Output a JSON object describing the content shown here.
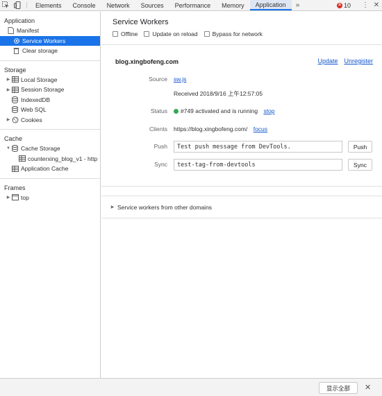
{
  "tabs": [
    {
      "label": "Elements"
    },
    {
      "label": "Console"
    },
    {
      "label": "Network"
    },
    {
      "label": "Sources"
    },
    {
      "label": "Performance"
    },
    {
      "label": "Memory"
    },
    {
      "label": "Application"
    }
  ],
  "active_tab": "Application",
  "tabs_more_glyph": "»",
  "error_count": "10",
  "sidebar": {
    "application": {
      "title": "Application",
      "items": [
        {
          "label": "Manifest",
          "icon": "document-icon"
        },
        {
          "label": "Service Workers",
          "icon": "gear-icon"
        },
        {
          "label": "Clear storage",
          "icon": "trash-icon"
        }
      ]
    },
    "storage": {
      "title": "Storage",
      "items": [
        {
          "label": "Local Storage",
          "icon": "grid-icon"
        },
        {
          "label": "Session Storage",
          "icon": "grid-icon"
        },
        {
          "label": "IndexedDB",
          "icon": "database-icon"
        },
        {
          "label": "Web SQL",
          "icon": "database-icon"
        },
        {
          "label": "Cookies",
          "icon": "cookie-icon"
        }
      ]
    },
    "cache": {
      "title": "Cache",
      "items": [
        {
          "label": "Cache Storage",
          "icon": "database-icon"
        },
        {
          "label": "counterxing_blog_v1 - http",
          "icon": "grid-icon"
        },
        {
          "label": "Application Cache",
          "icon": "grid-icon"
        }
      ]
    },
    "frames": {
      "title": "Frames",
      "items": [
        {
          "label": "top",
          "icon": "frame-icon"
        }
      ]
    }
  },
  "main": {
    "title": "Service Workers",
    "options": [
      {
        "label": "Offline",
        "checked": false
      },
      {
        "label": "Update on reload",
        "checked": false
      },
      {
        "label": "Bypass for network",
        "checked": false
      }
    ],
    "origin": "blog.xingbofeng.com",
    "update_link": "Update",
    "unregister_link": "Unregister",
    "source_label": "Source",
    "source_file": "sw.js",
    "received": "Received 2018/9/16 上午12:57:05",
    "status_label": "Status",
    "status_text": "#749 activated and is running",
    "stop_link": "stop",
    "clients_label": "Clients",
    "clients_url": "https://blog.xingbofeng.com/",
    "focus_link": "focus",
    "push_label": "Push",
    "push_value": "Test push message from DevTools.",
    "push_button": "Push",
    "sync_label": "Sync",
    "sync_value": "test-tag-from-devtools",
    "sync_button": "Sync",
    "other_domains": "Service workers from other domains"
  },
  "bottom": {
    "show_all": "显示全部"
  },
  "colors": {
    "accent": "#1a73e8",
    "link": "#1155cc",
    "status_green": "#34a853",
    "error_red": "#d93025"
  }
}
